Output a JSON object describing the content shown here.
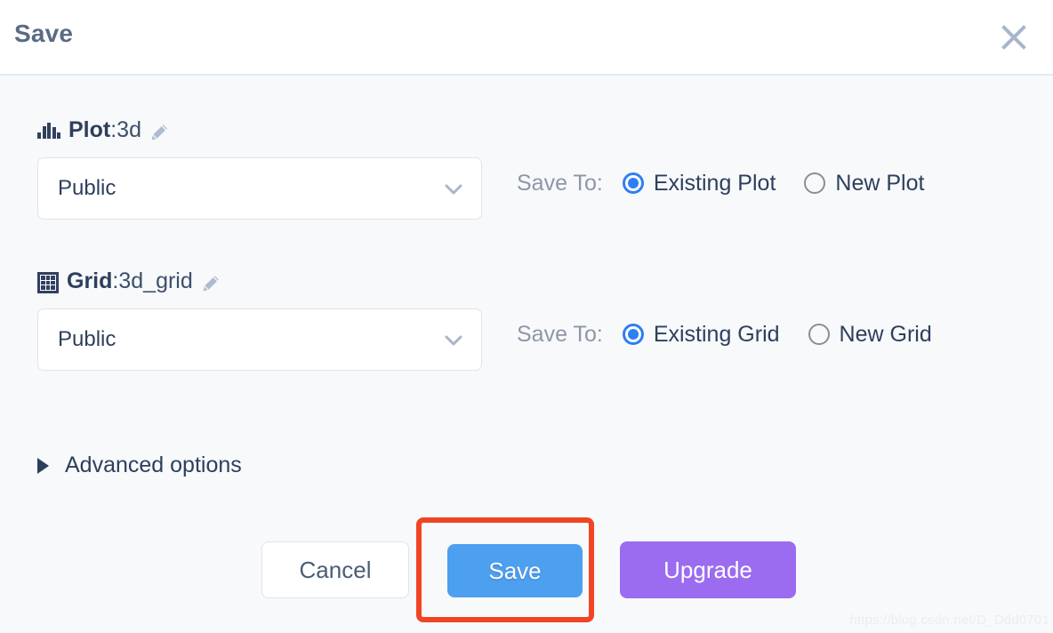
{
  "header": {
    "title": "Save",
    "close_icon": "close-icon"
  },
  "resources": [
    {
      "icon": "bar-chart-icon",
      "type_label": "Plot",
      "separator": ": ",
      "name": "3d",
      "edit_icon": "pencil-icon",
      "visibility": {
        "value": "Public",
        "chevron_icon": "chevron-down-icon"
      },
      "save_to": {
        "label": "Save To:",
        "options": [
          {
            "label": "Existing Plot",
            "selected": true
          },
          {
            "label": "New Plot",
            "selected": false
          }
        ]
      }
    },
    {
      "icon": "grid-icon",
      "type_label": "Grid",
      "separator": ": ",
      "name": "3d_grid",
      "edit_icon": "pencil-icon",
      "visibility": {
        "value": "Public",
        "chevron_icon": "chevron-down-icon"
      },
      "save_to": {
        "label": "Save To:",
        "options": [
          {
            "label": "Existing Grid",
            "selected": true
          },
          {
            "label": "New Grid",
            "selected": false
          }
        ]
      }
    }
  ],
  "advanced": {
    "label": "Advanced options",
    "disclosure_icon": "triangle-right-icon",
    "expanded": false
  },
  "footer": {
    "cancel_label": "Cancel",
    "save_label": "Save",
    "upgrade_label": "Upgrade"
  },
  "annotation": {
    "target": "save-button",
    "color": "#f04424"
  },
  "watermark": {
    "text": "https://blog.csdn.net/D_Ddd0701"
  },
  "colors": {
    "accent_blue": "#2f7ef2",
    "save_button": "#4d9ff0",
    "upgrade_button": "#9b6cf0",
    "title_text": "#5b6b84",
    "body_text": "#2e3f5c",
    "muted_text": "#8d97a6",
    "page_background": "#f7f9fb",
    "header_background": "#ffffff"
  }
}
